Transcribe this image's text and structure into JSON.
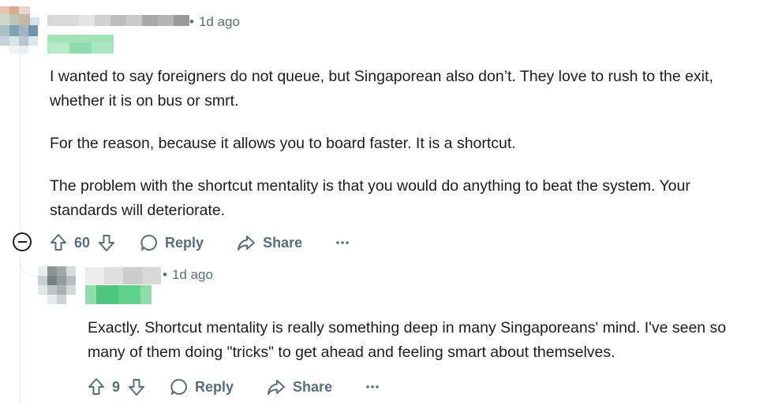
{
  "comments": [
    {
      "timestamp": "1d ago",
      "body": [
        "I wanted to say foreigners do not queue, but Singaporean also don’t. They love to rush to the exit, whether it is on bus or smrt.",
        "For the reason, because it allows you to board faster. It is a shortcut.",
        "The problem with the shortcut mentality is that you would do anything to beat the system. Your standards will deteriorate."
      ],
      "votes": "60",
      "reply_label": "Reply",
      "share_label": "Share"
    },
    {
      "timestamp": "1d ago",
      "body": [
        "Exactly. Shortcut mentality is really something deep in many Singaporeans' mind. I've seen so many of them doing \"tricks\" to get ahead and feeling smart about themselves."
      ],
      "votes": "9",
      "reply_label": "Reply",
      "share_label": "Share"
    }
  ],
  "colors": {
    "text": "#1c1c1c",
    "meta": "#576f76",
    "thread_line": "#e5ebee",
    "flair_green": "#5fd38d"
  },
  "icons": [
    "upvote-icon",
    "downvote-icon",
    "comment-bubble-icon",
    "share-arrow-icon",
    "more-dots-icon",
    "collapse-minus-icon"
  ]
}
